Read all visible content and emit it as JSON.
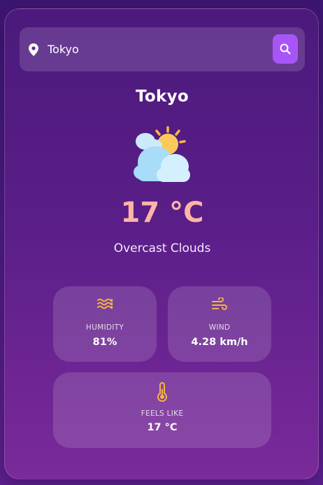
{
  "search": {
    "value": "Tokyo",
    "placeholder": ""
  },
  "city": "Tokyo",
  "weather": {
    "temperature": "17 °C",
    "description": "Overcast Clouds",
    "icon": "cloud-sun-icon"
  },
  "stats": {
    "humidity": {
      "label": "HUMIDITY",
      "value": "81%",
      "icon": "waves-icon"
    },
    "wind": {
      "label": "WIND",
      "value": "4.28 km/h",
      "icon": "wind-icon"
    },
    "feels_like": {
      "label": "FEELS LIKE",
      "value": "17 °C",
      "icon": "thermometer-icon"
    }
  },
  "colors": {
    "accent": "#a855f7",
    "temperature": "#ffb4a8",
    "stat_icon": "#f5b342"
  }
}
